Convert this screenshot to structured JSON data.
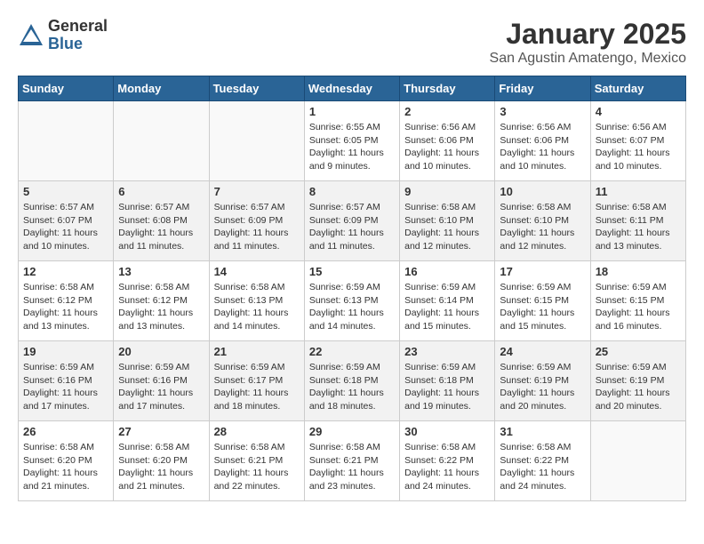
{
  "logo": {
    "general": "General",
    "blue": "Blue"
  },
  "header": {
    "title": "January 2025",
    "subtitle": "San Agustin Amatengo, Mexico"
  },
  "weekdays": [
    "Sunday",
    "Monday",
    "Tuesday",
    "Wednesday",
    "Thursday",
    "Friday",
    "Saturday"
  ],
  "weeks": [
    [
      {
        "day": "",
        "info": ""
      },
      {
        "day": "",
        "info": ""
      },
      {
        "day": "",
        "info": ""
      },
      {
        "day": "1",
        "info": "Sunrise: 6:55 AM\nSunset: 6:05 PM\nDaylight: 11 hours\nand 9 minutes."
      },
      {
        "day": "2",
        "info": "Sunrise: 6:56 AM\nSunset: 6:06 PM\nDaylight: 11 hours\nand 10 minutes."
      },
      {
        "day": "3",
        "info": "Sunrise: 6:56 AM\nSunset: 6:06 PM\nDaylight: 11 hours\nand 10 minutes."
      },
      {
        "day": "4",
        "info": "Sunrise: 6:56 AM\nSunset: 6:07 PM\nDaylight: 11 hours\nand 10 minutes."
      }
    ],
    [
      {
        "day": "5",
        "info": "Sunrise: 6:57 AM\nSunset: 6:07 PM\nDaylight: 11 hours\nand 10 minutes."
      },
      {
        "day": "6",
        "info": "Sunrise: 6:57 AM\nSunset: 6:08 PM\nDaylight: 11 hours\nand 11 minutes."
      },
      {
        "day": "7",
        "info": "Sunrise: 6:57 AM\nSunset: 6:09 PM\nDaylight: 11 hours\nand 11 minutes."
      },
      {
        "day": "8",
        "info": "Sunrise: 6:57 AM\nSunset: 6:09 PM\nDaylight: 11 hours\nand 11 minutes."
      },
      {
        "day": "9",
        "info": "Sunrise: 6:58 AM\nSunset: 6:10 PM\nDaylight: 11 hours\nand 12 minutes."
      },
      {
        "day": "10",
        "info": "Sunrise: 6:58 AM\nSunset: 6:10 PM\nDaylight: 11 hours\nand 12 minutes."
      },
      {
        "day": "11",
        "info": "Sunrise: 6:58 AM\nSunset: 6:11 PM\nDaylight: 11 hours\nand 13 minutes."
      }
    ],
    [
      {
        "day": "12",
        "info": "Sunrise: 6:58 AM\nSunset: 6:12 PM\nDaylight: 11 hours\nand 13 minutes."
      },
      {
        "day": "13",
        "info": "Sunrise: 6:58 AM\nSunset: 6:12 PM\nDaylight: 11 hours\nand 13 minutes."
      },
      {
        "day": "14",
        "info": "Sunrise: 6:58 AM\nSunset: 6:13 PM\nDaylight: 11 hours\nand 14 minutes."
      },
      {
        "day": "15",
        "info": "Sunrise: 6:59 AM\nSunset: 6:13 PM\nDaylight: 11 hours\nand 14 minutes."
      },
      {
        "day": "16",
        "info": "Sunrise: 6:59 AM\nSunset: 6:14 PM\nDaylight: 11 hours\nand 15 minutes."
      },
      {
        "day": "17",
        "info": "Sunrise: 6:59 AM\nSunset: 6:15 PM\nDaylight: 11 hours\nand 15 minutes."
      },
      {
        "day": "18",
        "info": "Sunrise: 6:59 AM\nSunset: 6:15 PM\nDaylight: 11 hours\nand 16 minutes."
      }
    ],
    [
      {
        "day": "19",
        "info": "Sunrise: 6:59 AM\nSunset: 6:16 PM\nDaylight: 11 hours\nand 17 minutes."
      },
      {
        "day": "20",
        "info": "Sunrise: 6:59 AM\nSunset: 6:16 PM\nDaylight: 11 hours\nand 17 minutes."
      },
      {
        "day": "21",
        "info": "Sunrise: 6:59 AM\nSunset: 6:17 PM\nDaylight: 11 hours\nand 18 minutes."
      },
      {
        "day": "22",
        "info": "Sunrise: 6:59 AM\nSunset: 6:18 PM\nDaylight: 11 hours\nand 18 minutes."
      },
      {
        "day": "23",
        "info": "Sunrise: 6:59 AM\nSunset: 6:18 PM\nDaylight: 11 hours\nand 19 minutes."
      },
      {
        "day": "24",
        "info": "Sunrise: 6:59 AM\nSunset: 6:19 PM\nDaylight: 11 hours\nand 20 minutes."
      },
      {
        "day": "25",
        "info": "Sunrise: 6:59 AM\nSunset: 6:19 PM\nDaylight: 11 hours\nand 20 minutes."
      }
    ],
    [
      {
        "day": "26",
        "info": "Sunrise: 6:58 AM\nSunset: 6:20 PM\nDaylight: 11 hours\nand 21 minutes."
      },
      {
        "day": "27",
        "info": "Sunrise: 6:58 AM\nSunset: 6:20 PM\nDaylight: 11 hours\nand 21 minutes."
      },
      {
        "day": "28",
        "info": "Sunrise: 6:58 AM\nSunset: 6:21 PM\nDaylight: 11 hours\nand 22 minutes."
      },
      {
        "day": "29",
        "info": "Sunrise: 6:58 AM\nSunset: 6:21 PM\nDaylight: 11 hours\nand 23 minutes."
      },
      {
        "day": "30",
        "info": "Sunrise: 6:58 AM\nSunset: 6:22 PM\nDaylight: 11 hours\nand 24 minutes."
      },
      {
        "day": "31",
        "info": "Sunrise: 6:58 AM\nSunset: 6:22 PM\nDaylight: 11 hours\nand 24 minutes."
      },
      {
        "day": "",
        "info": ""
      }
    ]
  ]
}
